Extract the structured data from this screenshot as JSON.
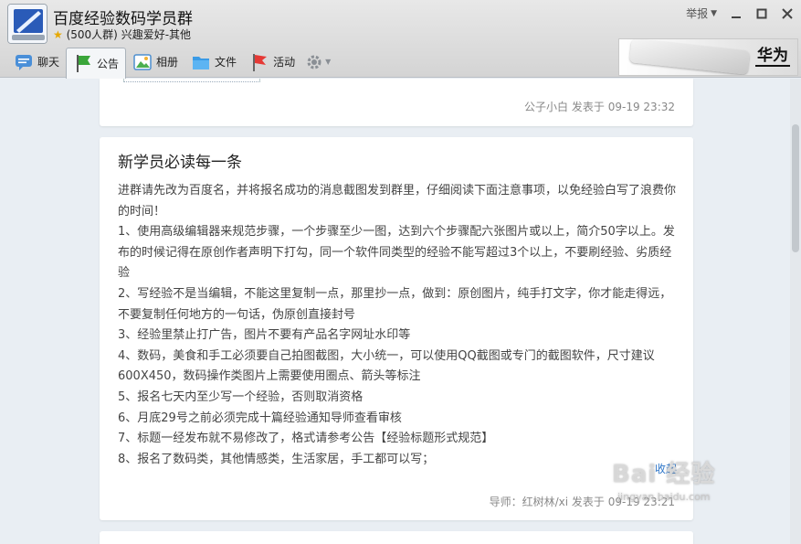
{
  "window": {
    "title": "百度经验数码学员群",
    "group_size": "(500人群)",
    "category": "兴趣爱好-其他",
    "report_label": "举报"
  },
  "tabs": [
    {
      "label": "聊天",
      "icon": "chat-icon"
    },
    {
      "label": "公告",
      "icon": "announcement-flag-icon",
      "active": true
    },
    {
      "label": "相册",
      "icon": "album-icon"
    },
    {
      "label": "文件",
      "icon": "folder-icon"
    },
    {
      "label": "活动",
      "icon": "activity-flag-icon"
    }
  ],
  "ad": {
    "brand": "华为"
  },
  "notices": [
    {
      "author": "公子小白",
      "posted_label": "发表于",
      "time": "09-19 23:32"
    },
    {
      "title": "新学员必读每一条",
      "paragraphs": [
        "进群请先改为百度名，并将报名成功的消息截图发到群里，仔细阅读下面注意事项，以免经验白写了浪费你的时间！",
        "1、使用高级编辑器来规范步骤，一个步骤至少一图，达到六个步骤配六张图片或以上，简介50字以上。发布的时候记得在原创作者声明下打勾，同一个软件同类型的经验不能写超过3个以上，不要刷经验、劣质经验",
        "2、写经验不是当编辑，不能这里复制一点，那里抄一点，做到：原创图片，纯手打文字，你才能走得远，不要复制任何地方的一句话，伪原创直接封号",
        "3、经验里禁止打广告，图片不要有产品名字网址水印等",
        "4、数码，美食和手工必须要自己拍图截图，大小统一，可以使用QQ截图或专门的截图软件，尺寸建议600X450，数码操作类图片上需要使用圈点、箭头等标注",
        "5、报名七天内至少写一个经验，否则取消资格",
        "6、月底29号之前必须完成十篇经验通知导师查看审核",
        "7、标题一经发布就不易修改了，格式请参考公告【经验标题形式规范】",
        "8、报名了数码类，其他情感类，生活家居，手工都可以写；"
      ],
      "collapse_label": "收起",
      "author": "导师：红树林/xi",
      "posted_label": "发表于",
      "time": "09-19 23:21"
    }
  ],
  "watermark": {
    "logo": "Bai 经验",
    "url": "jingyan.baidu.com"
  },
  "colors": {
    "link": "#2b74c8",
    "meta": "#888888",
    "background": "#e9eef3"
  }
}
